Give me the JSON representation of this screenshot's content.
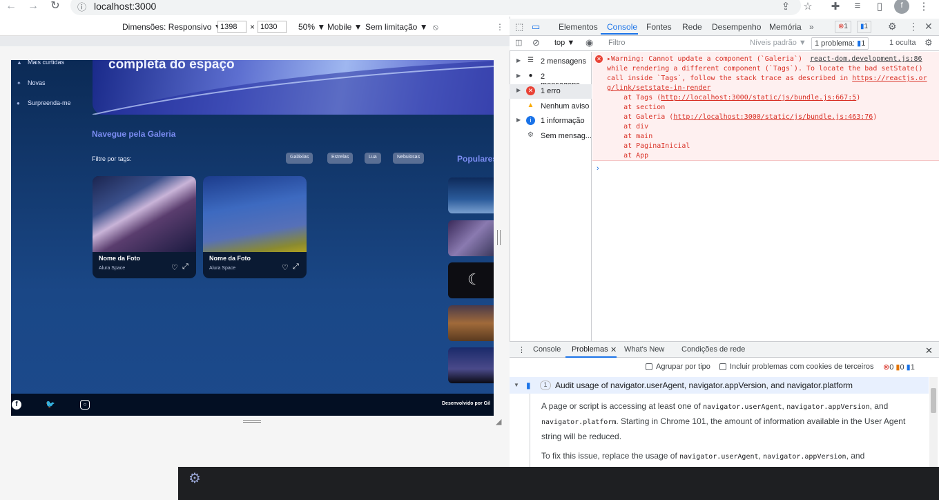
{
  "browser": {
    "url": "localhost:3000",
    "icons": [
      "arrow-back-icon",
      "arrow-forward-icon",
      "reload-icon",
      "info-icon",
      "share-icon",
      "star-icon",
      "extensions-icon",
      "media-icon",
      "sidebar-icon",
      "profile-icon",
      "menu-icon"
    ]
  },
  "device_toolbar": {
    "dimensions_label": "Dimensões: Responsivo ▼",
    "width": "1398",
    "times": "×",
    "height": "1030",
    "zoom": "50% ▼",
    "device_type": "Mobile ▼",
    "throttle": "Sem limitação ▼"
  },
  "site": {
    "hero_text": "completa do espaço",
    "nav_items": [
      "Mais curtidas",
      "Novas",
      "Surpreenda-me"
    ],
    "gallery_title": "Navegue pela Galeria",
    "filter_label": "Filtre por tags:",
    "tags": [
      "Galáxias",
      "Estrelas",
      "Lua",
      "Nebulosas"
    ],
    "popular_title": "Populares",
    "cards": [
      {
        "name": "Nome da Foto",
        "source": "Alura Space"
      },
      {
        "name": "Nome da Foto",
        "source": "Alura Space"
      }
    ],
    "footer_credit": "Desenvolvido por Gil"
  },
  "devtools": {
    "tabs": [
      "Elementos",
      "Console",
      "Fontes",
      "Rede",
      "Desempenho",
      "Memória"
    ],
    "active_tab": "Console",
    "error_count": "1",
    "message_count": "1",
    "context": "top ▼",
    "filter_placeholder": "Filtro",
    "levels": "Níveis padrão ▼",
    "problems_label": "1 problema:",
    "problems_count": "1",
    "hidden": "1 oculta",
    "sidebar": [
      "2 mensagens",
      "2 mensagens...",
      "1 erro",
      "Nenhum aviso",
      "1 informação",
      "Sem mensag..."
    ],
    "error_lines": [
      "Warning: Cannot update a component (`Galeria`)",
      "while rendering a different component (`Tags`). To locate the bad setState()",
      "call inside `Tags`, follow the stack trace as described in ",
      "g/link/setstate-in-render",
      "    at Tags (",
      "    at section",
      "    at Galeria (",
      "    at div",
      "    at main",
      "    at PaginaInicial",
      "    at App"
    ],
    "error_source": "react-dom.development.js:86",
    "error_link1": "https://reactjs.or",
    "error_link_tags": "http://localhost:3000/static/js/bundle.js:667:5",
    "error_link_galeria": "http://localhost:3000/static/js/bundle.js:463:76",
    "prompt": "›"
  },
  "drawer": {
    "tabs": [
      "Console",
      "Problemas",
      "What's New",
      "Condições de rede"
    ],
    "active_tab": "Problemas",
    "group_by": "Agrupar por tipo",
    "include_third_party": "Incluir problemas com cookies de terceiros",
    "counts": [
      "0",
      "0",
      "1"
    ],
    "issue_count": "1",
    "issue_title": "Audit usage of navigator.userAgent, navigator.appVersion, and navigator.platform",
    "issue_p1_a": "A page or script is accessing at least one of ",
    "issue_p1_code1": "navigator.userAgent",
    "issue_p1_code2": "navigator.appVersion",
    "issue_p1_and": ", and",
    "issue_p1_code3": "navigator.platform",
    "issue_p1_b": ". Starting in Chrome 101, the amount of information available in the User Agent string will be reduced.",
    "issue_p2_a": "To fix this issue, replace the usage of ",
    "issue_p2_code1": "navigator.userAgent",
    "issue_p2_code2": "navigator.appVersion",
    "issue_p2_and": ", and"
  }
}
